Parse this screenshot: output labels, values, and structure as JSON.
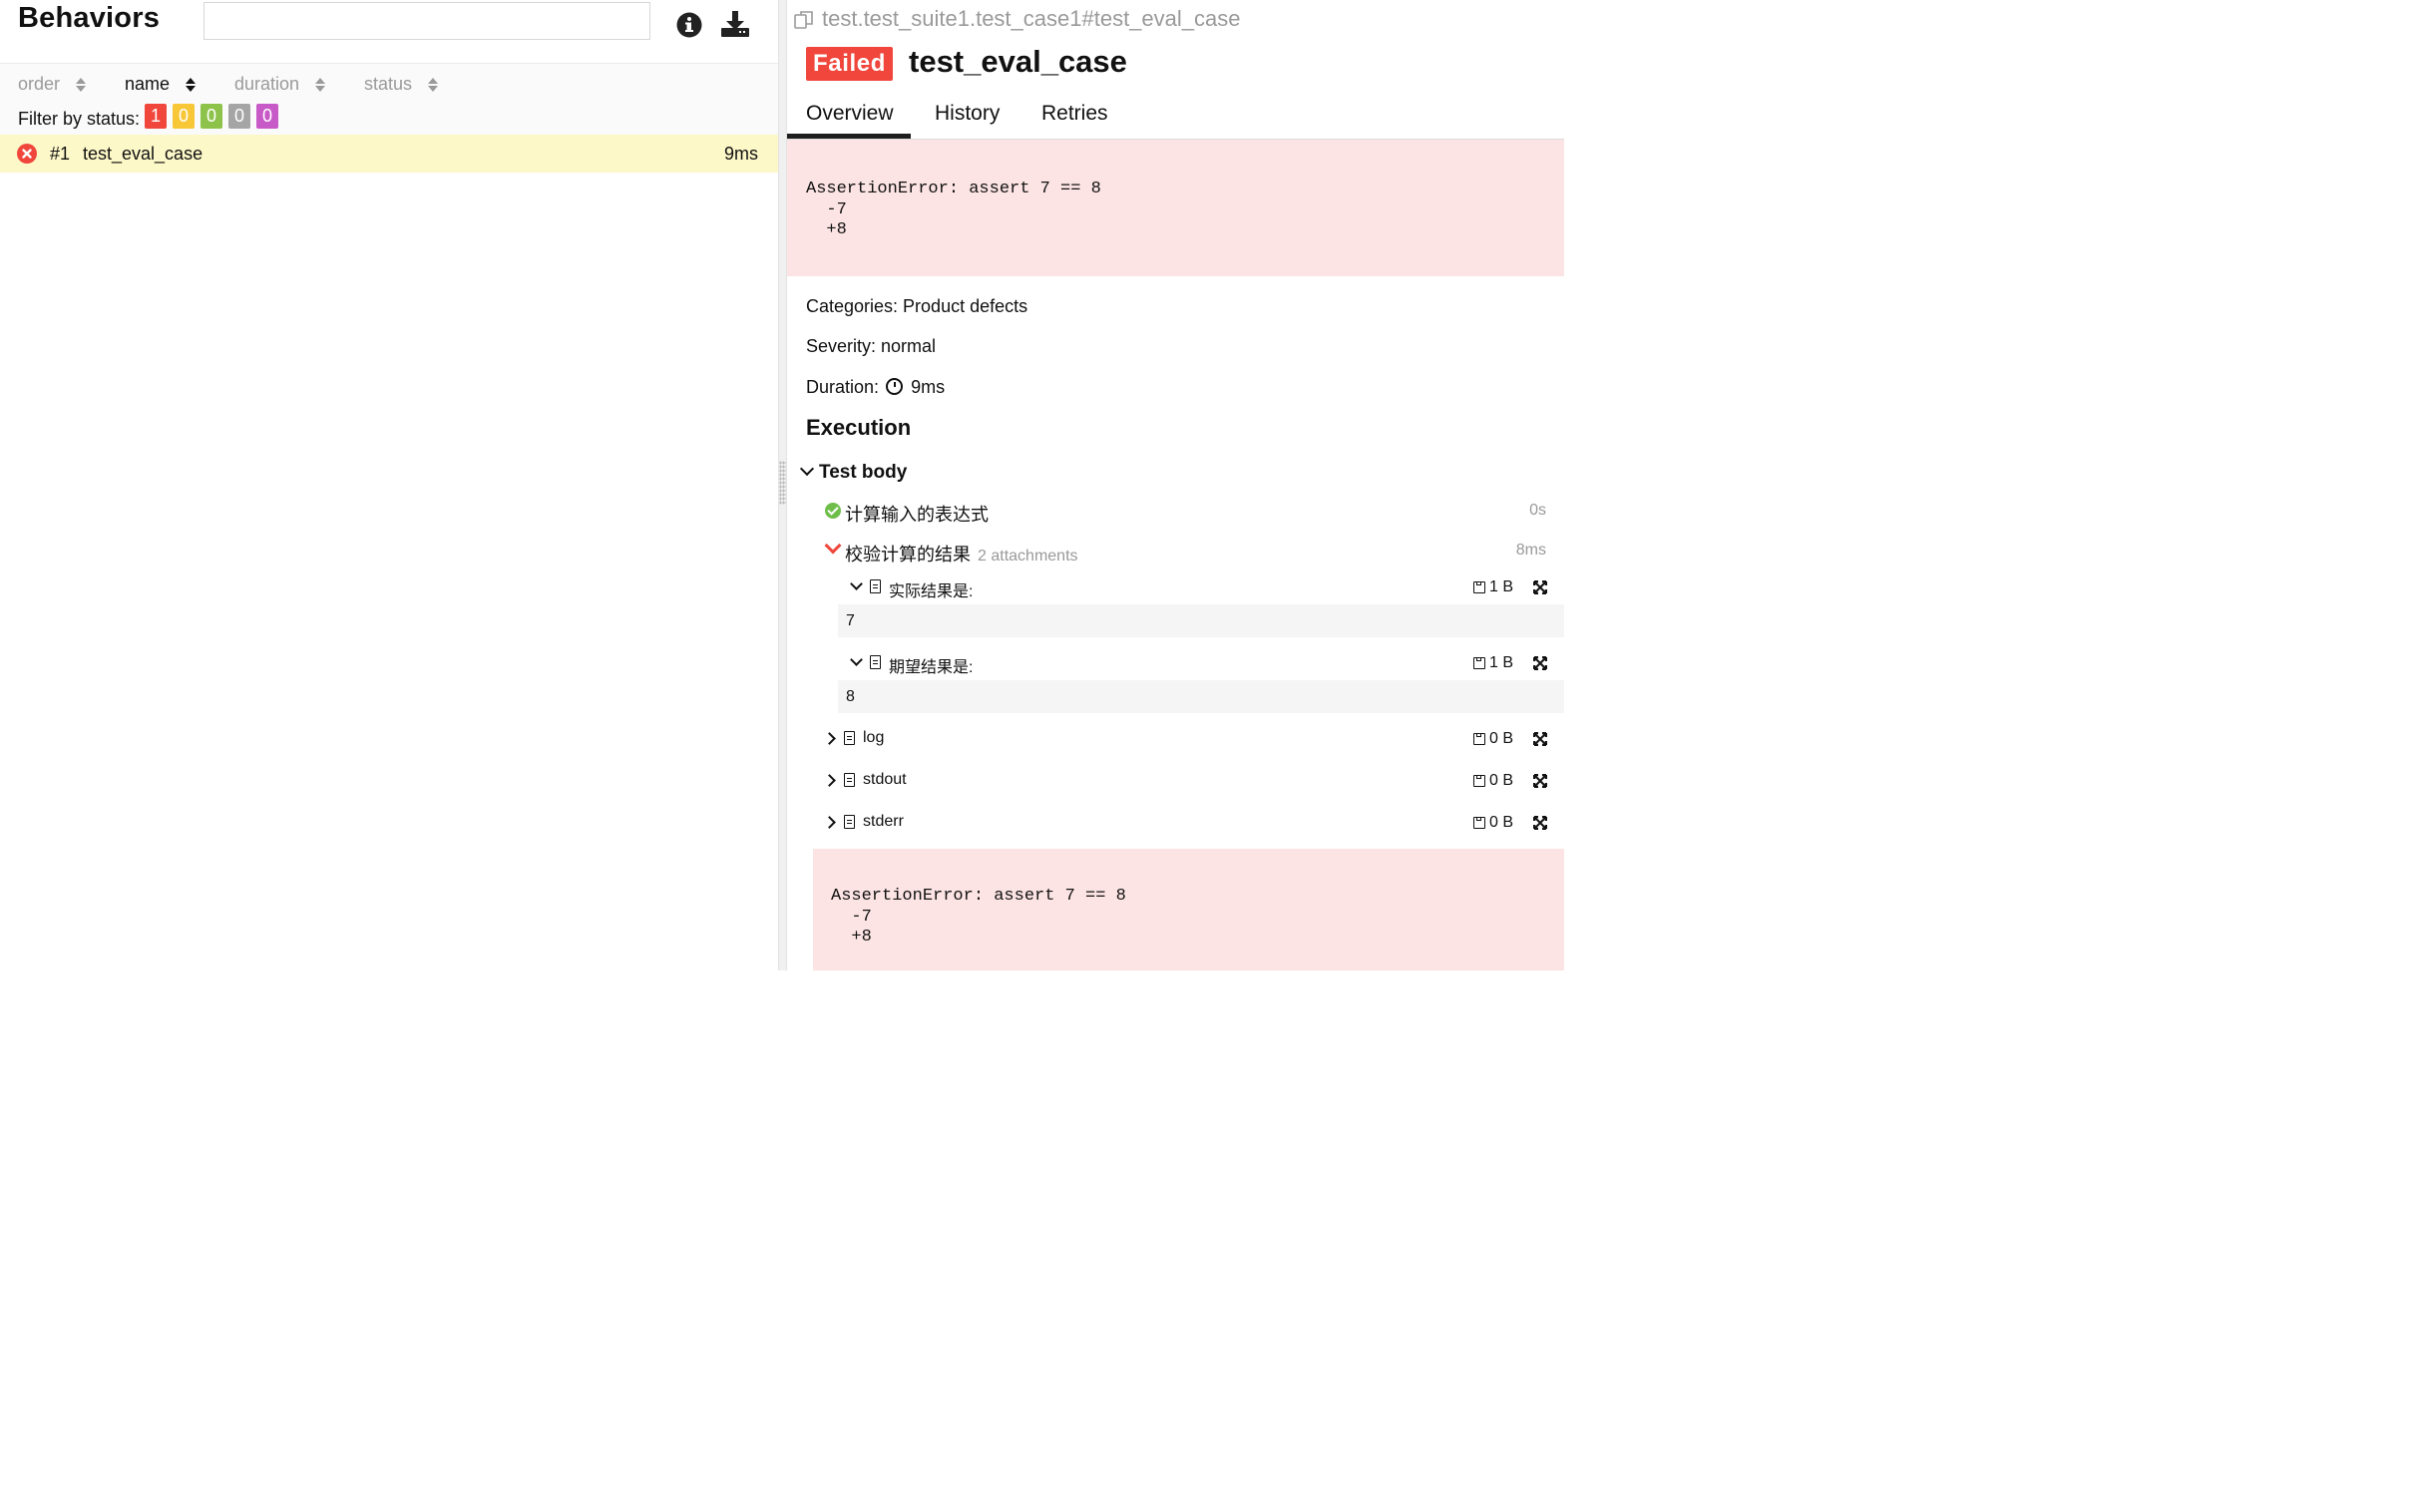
{
  "left": {
    "title": "Behaviors",
    "search": {
      "value": "",
      "placeholder": ""
    },
    "toolbar_icons": {
      "info": "info-icon",
      "download": "download-icon"
    },
    "sort": {
      "columns": [
        "order",
        "name",
        "duration",
        "status"
      ],
      "active": "name"
    },
    "filter": {
      "label": "Filter by status:",
      "counts": [
        {
          "status": "failed",
          "value": "1",
          "color": "#f0463c"
        },
        {
          "status": "broken",
          "value": "0",
          "color": "#f7c737"
        },
        {
          "status": "passed",
          "value": "0",
          "color": "#8dc34a"
        },
        {
          "status": "skipped",
          "value": "0",
          "color": "#a5a5a5"
        },
        {
          "status": "unknown",
          "value": "0",
          "color": "#c85ac7"
        }
      ]
    },
    "rows": [
      {
        "number": "#1",
        "name": "test_eval_case",
        "duration": "9ms",
        "status": "failed"
      }
    ]
  },
  "right": {
    "path": "test.test_suite1.test_case1#test_eval_case",
    "status_label": "Failed",
    "title": "test_eval_case",
    "tabs": [
      "Overview",
      "History",
      "Retries"
    ],
    "active_tab": "Overview",
    "error_text": "AssertionError: assert 7 == 8\n  -7\n  +8",
    "categories": "Categories: Product defects",
    "severity": "Severity: normal",
    "duration_label": "Duration:",
    "duration_value": "9ms",
    "execution_heading": "Execution",
    "test_body": "Test body",
    "steps": [
      {
        "name": "计算输入的表达式",
        "duration": "0s",
        "status": "passed"
      },
      {
        "name": "校验计算的结果",
        "attachments_note": "2 attachments",
        "duration": "8ms",
        "status": "failed"
      }
    ],
    "step_attachments": [
      {
        "name": "实际结果是:",
        "size": "1 B",
        "content": "7"
      },
      {
        "name": "期望结果是:",
        "size": "1 B",
        "content": "8"
      }
    ],
    "body_attachments": [
      {
        "name": "log",
        "size": "0 B"
      },
      {
        "name": "stdout",
        "size": "0 B"
      },
      {
        "name": "stderr",
        "size": "0 B"
      }
    ]
  },
  "colors": {
    "failed": "#f0463c",
    "passed": "#6fbe4a",
    "row_highlight": "#fdf8c8",
    "error_background": "#fde4e4"
  }
}
